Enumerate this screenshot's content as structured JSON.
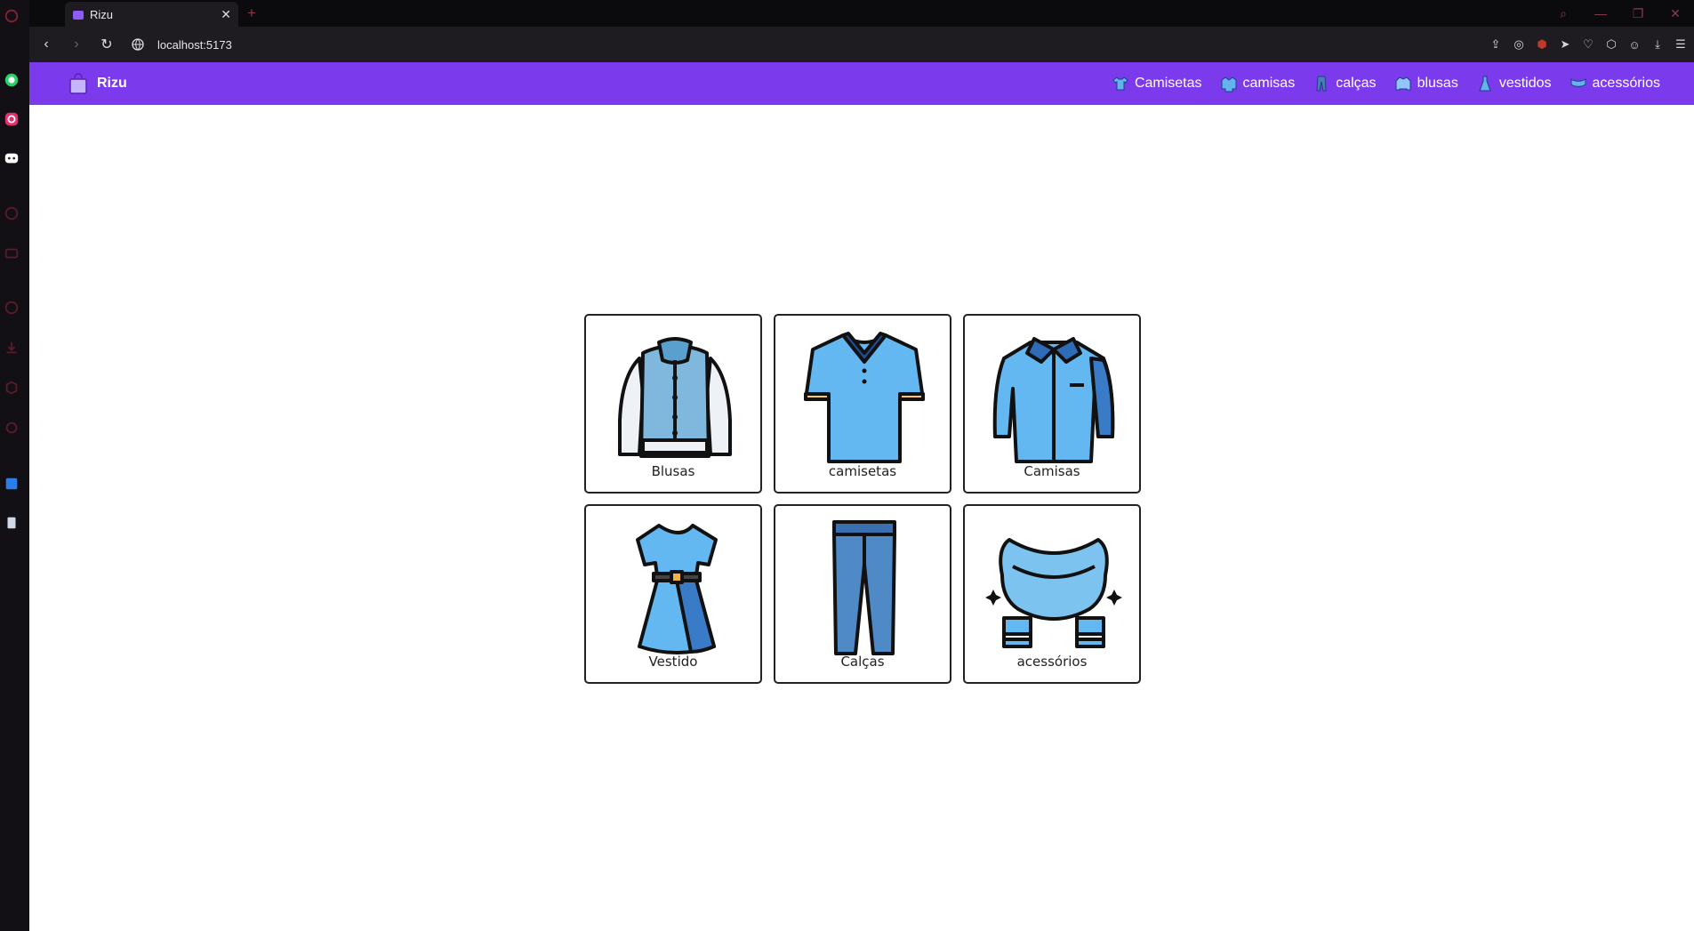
{
  "browser": {
    "tab_title": "Rizu",
    "tab_close": "✕",
    "new_tab": "+",
    "url": "localhost:5173"
  },
  "header": {
    "brand": "Rizu",
    "nav": [
      {
        "label": "Camisetas",
        "icon": "tshirt-icon"
      },
      {
        "label": "camisas",
        "icon": "shirt-icon"
      },
      {
        "label": "calças",
        "icon": "pants-icon"
      },
      {
        "label": "blusas",
        "icon": "jacket-icon"
      },
      {
        "label": "vestidos",
        "icon": "dress-icon"
      },
      {
        "label": "acessórios",
        "icon": "scarf-icon"
      }
    ]
  },
  "categories": [
    {
      "label": "Blusas",
      "icon": "jacket-icon"
    },
    {
      "label": "camisetas",
      "icon": "polo-shirt-icon"
    },
    {
      "label": "Camisas",
      "icon": "shirt-icon"
    },
    {
      "label": "Vestido",
      "icon": "dress-icon"
    },
    {
      "label": "Calças",
      "icon": "jeans-icon"
    },
    {
      "label": "acessórios",
      "icon": "scarf-icon"
    }
  ],
  "colors": {
    "header_bg": "#7c3aed",
    "cloth_blue": "#63b3ed",
    "cloth_dark": "#3a7bd5"
  }
}
